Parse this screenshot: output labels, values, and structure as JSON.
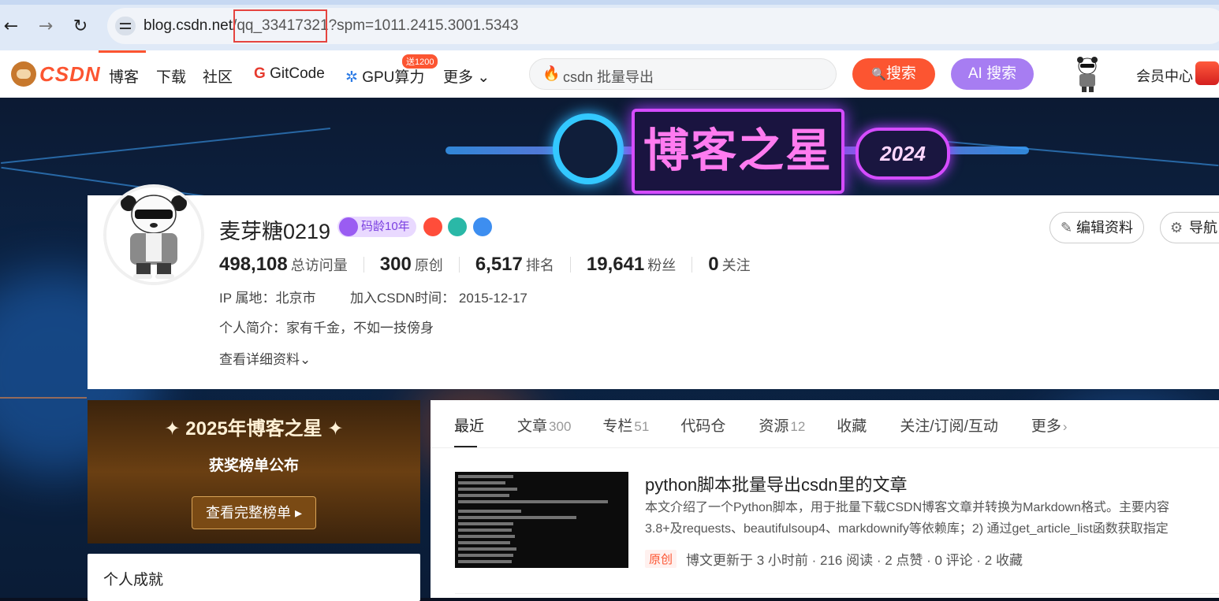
{
  "browser": {
    "back_icon": "←",
    "forward_icon": "→",
    "reload_icon": "↻",
    "url_domain": "blog.csdn.net",
    "url_slash": "/",
    "url_path": "qq_33417321",
    "url_query": "?spm=1011.2415.3001.5343"
  },
  "topnav": {
    "logo_text": "CSDN",
    "items": [
      "博客",
      "下载",
      "社区"
    ],
    "gitcode_g": "G",
    "gitcode_label": "GitCode",
    "gpu_icon": "✲",
    "gpu_label": "GPU算力",
    "gpu_badge": "送1200",
    "more_label": "更多 ⌄",
    "search_placeholder": "csdn 批量导出",
    "search_button": "搜索",
    "ai_search_button": "AI 搜索",
    "member_center": "会员中心",
    "flame_icon": "🔥",
    "search_icon": "🔍"
  },
  "banner": {
    "title": "博客之星",
    "year": "2024"
  },
  "profile": {
    "username": "麦芽糖0219",
    "age_badge": "码龄10年",
    "edit_button": "编辑资料",
    "guide_button": "导航",
    "stats": [
      {
        "num": "498,108",
        "label": "总访问量"
      },
      {
        "num": "300",
        "label": "原创"
      },
      {
        "num": "6,517",
        "label": "排名"
      },
      {
        "num": "19,641",
        "label": "粉丝"
      },
      {
        "num": "0",
        "label": "关注"
      }
    ],
    "ip_location": "IP 属地：北京市",
    "join_time": "加入CSDN时间：  2015-12-17",
    "bio": "个人简介：家有千金，不如一技傍身",
    "detail_link": "查看详细资料⌄",
    "honor_colors": [
      "#ff4d3a",
      "#2ab8a7",
      "#3d8ef0"
    ]
  },
  "award": {
    "title": "✦ 2025年博客之星 ✦",
    "subtitle": "获奖榜单公布",
    "button": "查看完整榜单 ▸"
  },
  "achievement": {
    "title": "个人成就"
  },
  "tabs": [
    {
      "label": "最近",
      "count": ""
    },
    {
      "label": "文章",
      "count": "300"
    },
    {
      "label": "专栏",
      "count": "51"
    },
    {
      "label": "代码仓",
      "count": ""
    },
    {
      "label": "资源",
      "count": "12"
    },
    {
      "label": "收藏",
      "count": ""
    },
    {
      "label": "关注/订阅/互动",
      "count": ""
    },
    {
      "label": "更多",
      "count": "›"
    }
  ],
  "article": {
    "title": "python脚本批量导出csdn里的文章",
    "desc_line1": "本文介绍了一个Python脚本，用于批量下载CSDN博客文章并转换为Markdown格式。主要内容",
    "desc_line2": "3.8+及requests、beautifulsoup4、markdownify等依赖库；2) 通过get_article_list函数获取指定",
    "tag": "原创",
    "meta": "博文更新于 3 小时前 ·  216 阅读 ·  2 点赞 ·  0 评论 ·  2 收藏"
  },
  "colors": {
    "brand": "#fc5531",
    "ai_purple": "#a77df2",
    "highlight_red": "#e5443f"
  }
}
